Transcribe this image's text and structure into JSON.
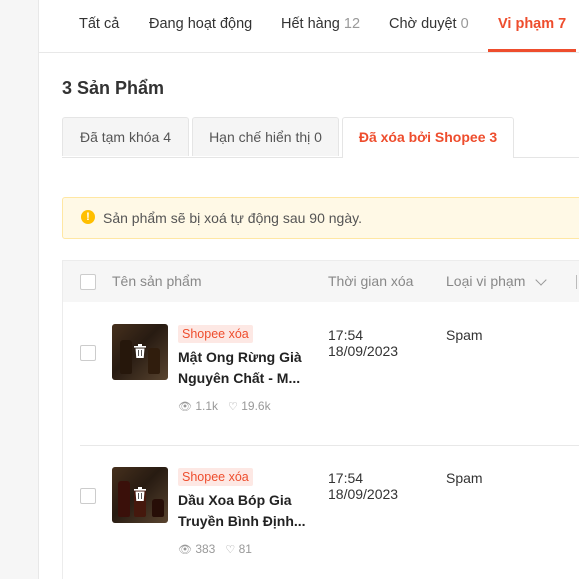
{
  "main_tabs": [
    {
      "label": "Tất cả",
      "count": ""
    },
    {
      "label": "Đang hoạt động",
      "count": ""
    },
    {
      "label": "Hết hàng",
      "count": "12"
    },
    {
      "label": "Chờ duyệt",
      "count": "0"
    },
    {
      "label": "Vi phạm",
      "count": "7"
    }
  ],
  "section_title": "3 Sản Phẩm",
  "sub_tabs": [
    {
      "label": "Đã tạm khóa 4"
    },
    {
      "label": "Hạn chế hiển thị 0"
    },
    {
      "label": "Đã xóa bởi Shopee 3"
    }
  ],
  "notice": {
    "icon": "warning-icon",
    "text": "Sản phẩm sẽ bị xoá tự động sau 90 ngày."
  },
  "table": {
    "headers": {
      "name": "Tên sản phẩm",
      "time": "Thời gian xóa",
      "violation": "Loại vi phạm"
    },
    "rows": [
      {
        "badge": "Shopee xóa",
        "name_line1": "Mật Ong Rừng Già",
        "name_line2": "Nguyên Chất - M...",
        "views": "1.1k",
        "likes": "19.6k",
        "time": "17:54",
        "date": "18/09/2023",
        "violation": "Spam"
      },
      {
        "badge": "Shopee xóa",
        "name_line1": "Dầu Xoa Bóp Gia",
        "name_line2": "Truyền Bình Định...",
        "views": "383",
        "likes": "81",
        "time": "17:54",
        "date": "18/09/2023",
        "violation": "Spam"
      }
    ]
  },
  "colors": {
    "accent": "#ee4d2d",
    "notice_bg": "#fff9e6",
    "warning": "#ffbf00"
  }
}
